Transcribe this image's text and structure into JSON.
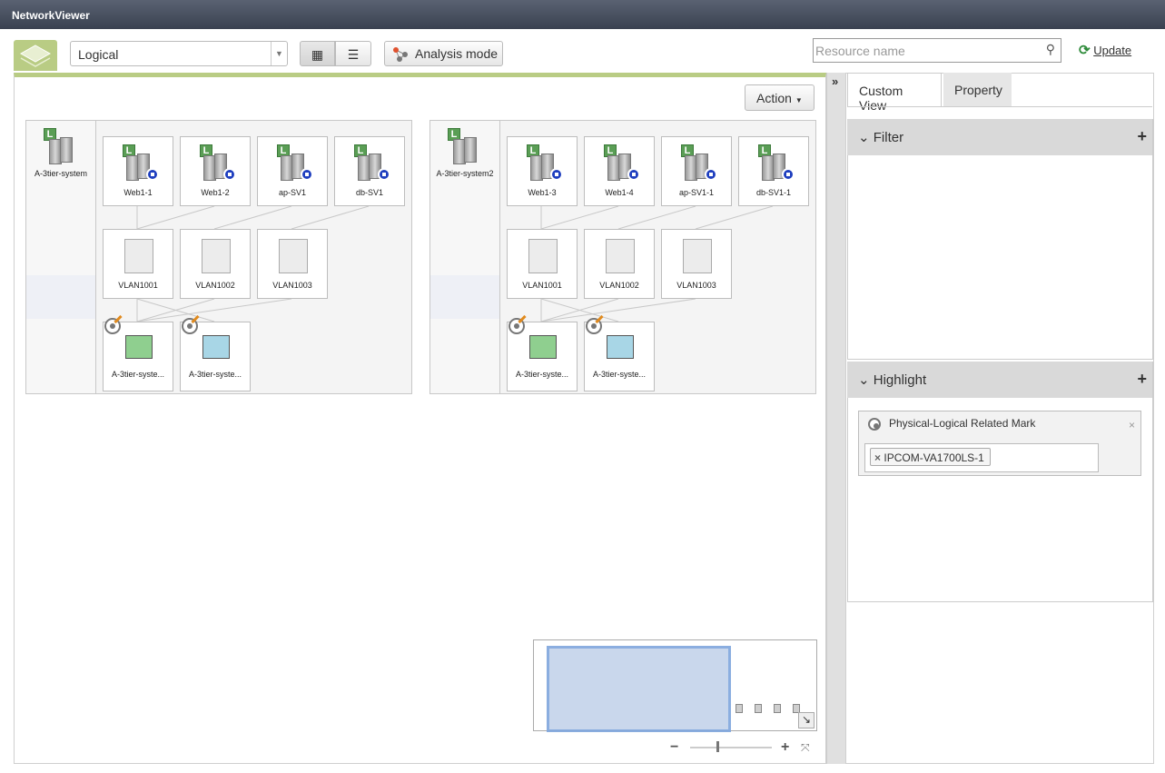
{
  "app": {
    "title": "NetworkViewer"
  },
  "toolbar": {
    "view_select": "Logical",
    "analysis_label": "Analysis mode",
    "search_placeholder": "Resource name",
    "update_label": "Update",
    "action_label": "Action"
  },
  "right_panel": {
    "tabs": [
      "Custom View",
      "Property"
    ],
    "active_tab": "Custom View",
    "filter_title": "Filter",
    "highlight_title": "Highlight",
    "highlight_item": {
      "label": "Physical-Logical Related Mark",
      "tag": "IPCOM-VA1700LS-1"
    }
  },
  "groups": [
    {
      "name": "A-3tier-system",
      "servers": [
        "Web1-1",
        "Web1-2",
        "ap-SV1",
        "db-SV1"
      ],
      "vlans": [
        "VLAN1001",
        "VLAN1002",
        "VLAN1003"
      ],
      "devices": [
        "A-3tier-syste...",
        "A-3tier-syste..."
      ]
    },
    {
      "name": "A-3tier-system2",
      "servers": [
        "Web1-3",
        "Web1-4",
        "ap-SV1-1",
        "db-SV1-1"
      ],
      "vlans": [
        "VLAN1001",
        "VLAN1002",
        "VLAN1003"
      ],
      "devices": [
        "A-3tier-syste...",
        "A-3tier-syste..."
      ]
    }
  ],
  "colors": {
    "accent_green": "#b9cc84",
    "title_bar": "#3a4150",
    "server_blue": "#1f3fbf"
  }
}
